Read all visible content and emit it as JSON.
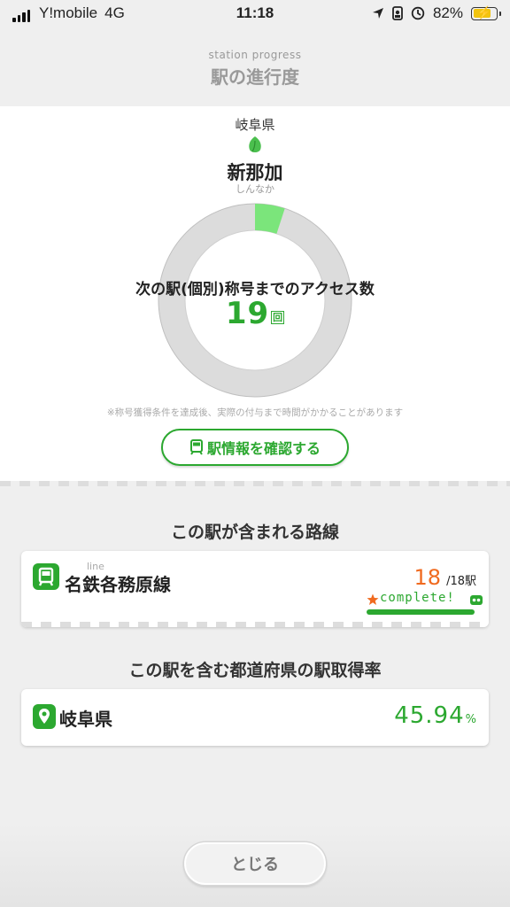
{
  "status_bar": {
    "carrier": "Y!mobile",
    "network": "4G",
    "time": "11:18",
    "battery_percent": "82%",
    "battery_level": 0.82
  },
  "header": {
    "subtitle": "station progress",
    "title": "駅の進行度"
  },
  "station": {
    "prefecture": "岐阜県",
    "name": "新那加",
    "reading": "しんなか",
    "progress_label": "次の駅(個別)称号までのアクセス数",
    "access_count": "19",
    "access_unit": "回",
    "progress_fraction": 0.05,
    "note": "※称号獲得条件を達成後、実際の付与まで時間がかかることがあります",
    "info_button": "駅情報を確認する"
  },
  "lines_section": {
    "title": "この駅が含まれる路線",
    "items": [
      {
        "sub": "line",
        "name": "名鉄各務原線",
        "acquired": "18",
        "total": "/18駅",
        "complete_label": "complete!"
      }
    ]
  },
  "prefecture_section": {
    "title": "この駅を含む都道府県の駅取得率",
    "name": "岐阜県",
    "rate": "45.94",
    "rate_unit": "%"
  },
  "close_button": "とじる",
  "colors": {
    "accent_green": "#2ca830",
    "progress_green": "#7be57b",
    "count_orange": "#f06a1f",
    "ring_gray": "#dcdcdc"
  }
}
